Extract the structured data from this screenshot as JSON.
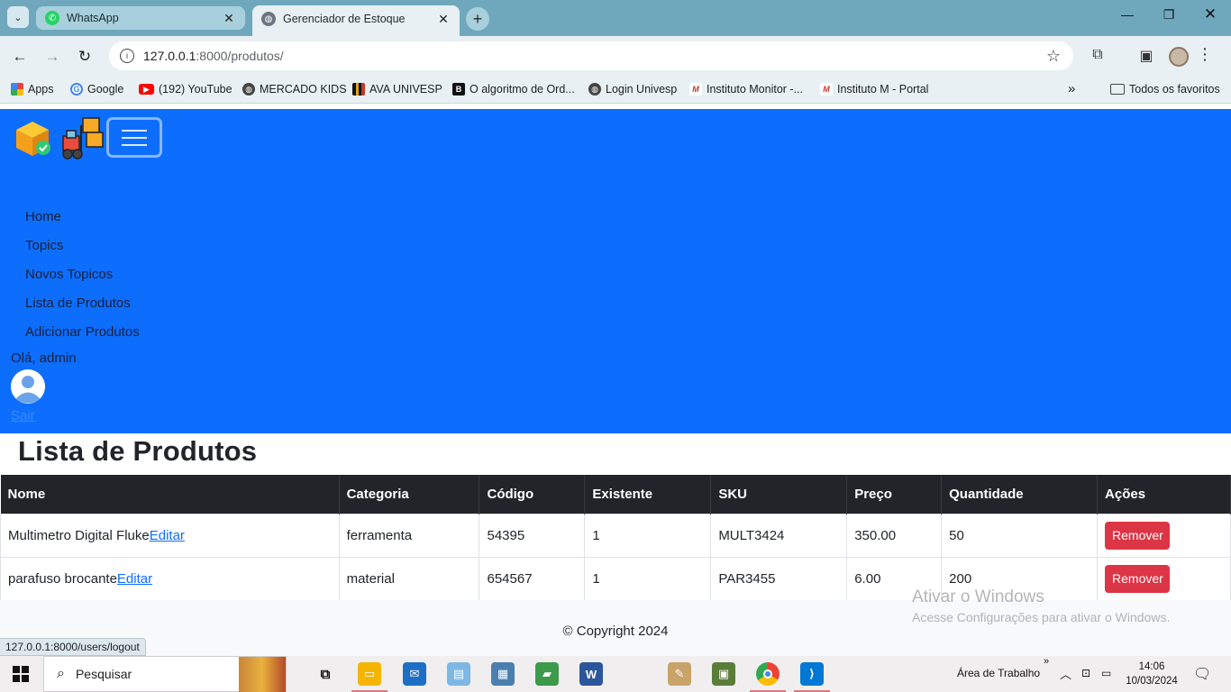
{
  "browser": {
    "tabs": [
      {
        "title": "WhatsApp",
        "active": false
      },
      {
        "title": "Gerenciador de Estoque",
        "active": true
      }
    ],
    "url_host": "127.0.0.1",
    "url_path": ":8000/produtos/",
    "bookmarks": [
      {
        "label": "Apps",
        "icon": "apps-grid-icon"
      },
      {
        "label": "Google",
        "icon": "google-icon"
      },
      {
        "label": "(192) YouTube",
        "icon": "youtube-icon"
      },
      {
        "label": "MERCADO KIDS",
        "icon": "globe-icon"
      },
      {
        "label": "AVA UNIVESP",
        "icon": "bars-icon"
      },
      {
        "label": "O algoritmo de Ord...",
        "icon": "book-icon"
      },
      {
        "label": "Login Univesp",
        "icon": "globe-icon"
      },
      {
        "label": "Instituto Monitor -...",
        "icon": "instituto-icon"
      },
      {
        "label": "Instituto M - Portal",
        "icon": "instituto-icon"
      }
    ],
    "all_bookmarks": "Todos os favoritos",
    "status_url": "127.0.0.1:8000/users/logout"
  },
  "nav": {
    "items": [
      "Home",
      "Topics",
      "Novos Topicos",
      "Lista de Produtos",
      "Adicionar Produtos"
    ],
    "greeting": "Olá, admin",
    "logout": "Sair"
  },
  "main": {
    "title": "Lista de Produtos",
    "columns": [
      "Nome",
      "Categoria",
      "Código",
      "Existente",
      "SKU",
      "Preço",
      "Quantidade",
      "Ações"
    ],
    "rows": [
      {
        "nome": "Multimetro Digital Fluke",
        "edit": "Editar",
        "categoria": "ferramenta",
        "codigo": "54395",
        "existente": "1",
        "sku": "MULT3424",
        "preco": "350.00",
        "quantidade": "50",
        "acao": "Remover"
      },
      {
        "nome": "parafuso brocante",
        "edit": "Editar",
        "categoria": "material",
        "codigo": "654567",
        "existente": "1",
        "sku": "PAR3455",
        "preco": "6.00",
        "quantidade": "200",
        "acao": "Remover"
      }
    ],
    "footer": "© Copyright 2024"
  },
  "watermark": {
    "line1": "Ativar o Windows",
    "line2": "Acesse Configurações para ativar o Windows."
  },
  "taskbar": {
    "search": "Pesquisar",
    "desktop_label": "Área de Trabalho",
    "time": "14:06",
    "date": "10/03/2024"
  },
  "colors": {
    "navbar": "#0d6efd",
    "table_header": "#212529",
    "remove_button": "#dc3545",
    "tabstrip": "#6fa8bd"
  }
}
